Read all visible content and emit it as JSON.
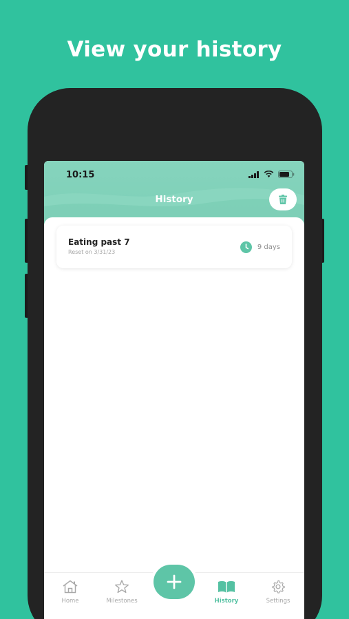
{
  "headline": "View your history",
  "status": {
    "time": "10:15"
  },
  "header": {
    "title": "History"
  },
  "history": {
    "items": [
      {
        "title": "Eating past 7",
        "subtitle": "Reset on 3/31/23",
        "duration": "9 days"
      }
    ]
  },
  "tabs": [
    {
      "label": "Home",
      "icon": "home-icon"
    },
    {
      "label": "Milestones",
      "icon": "star-icon"
    },
    {
      "label": "History",
      "icon": "book-icon",
      "active": true
    },
    {
      "label": "Settings",
      "icon": "gear-icon"
    }
  ],
  "add_button": {
    "icon": "plus-icon"
  },
  "colors": {
    "background": "#30c29e",
    "accent": "#5ec5a7",
    "header": "#7ccfb7",
    "frame": "#232323"
  }
}
